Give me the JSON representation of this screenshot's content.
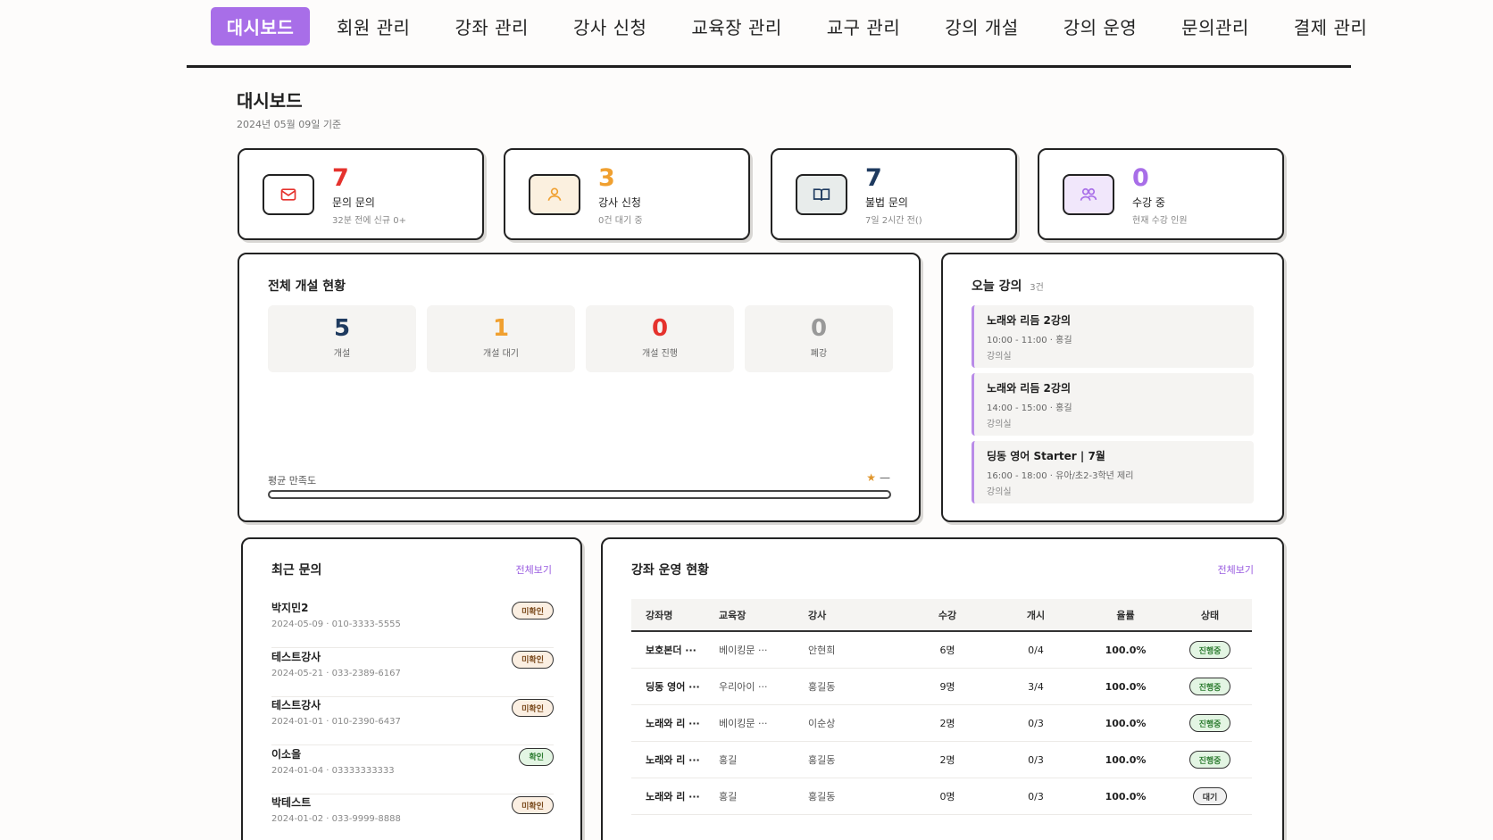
{
  "nav": {
    "items": [
      {
        "label": "대시보드",
        "active": true
      },
      {
        "label": "회원 관리",
        "active": false
      },
      {
        "label": "강좌 관리",
        "active": false
      },
      {
        "label": "강사 신청",
        "active": false
      },
      {
        "label": "교육장 관리",
        "active": false
      },
      {
        "label": "교구 관리",
        "active": false
      },
      {
        "label": "강의 개설",
        "active": false
      },
      {
        "label": "강의 운영",
        "active": false
      },
      {
        "label": "문의관리",
        "active": false
      },
      {
        "label": "결제 관리",
        "active": false
      }
    ]
  },
  "header": {
    "title": "대시보드",
    "date": "2024년 05월 09일 기준"
  },
  "colors": {
    "accent": "#a86ee8",
    "red": "#e5322d",
    "orange": "#f0a030",
    "navy": "#1e3a5f",
    "purple": "#a86ee8"
  },
  "stats": [
    {
      "icon": "mail-icon",
      "value": "7",
      "label": "문의 문의",
      "sub": "32분 전에 신규 0+",
      "color": "#e5322d",
      "icon_bg": "#fff",
      "icon_color": "#e5322d"
    },
    {
      "icon": "person-icon",
      "value": "3",
      "label": "강사 신청",
      "sub": "0건 대기 중",
      "color": "#f0a030",
      "icon_bg": "#fbf0df",
      "icon_color": "#f0a030"
    },
    {
      "icon": "book-icon",
      "value": "7",
      "label": "불법 문의",
      "sub": "7일 2시간 전()",
      "color": "#1e3a5f",
      "icon_bg": "#e8eceb",
      "icon_color": "#1e3a5f"
    },
    {
      "icon": "users-icon",
      "value": "0",
      "label": "수강 중",
      "sub": "현재 수강 인원",
      "color": "#a86ee8",
      "icon_bg": "#f1e7fb",
      "icon_color": "#a86ee8"
    }
  ],
  "overall": {
    "title": "전체 개설 현황",
    "kpis": [
      {
        "value": "5",
        "label": "개설",
        "color": "#1e3a5f"
      },
      {
        "value": "1",
        "label": "개설 대기",
        "color": "#f0a030"
      },
      {
        "value": "0",
        "label": "개설 진행",
        "color": "#e5322d"
      },
      {
        "value": "0",
        "label": "폐강",
        "color": "#999999"
      }
    ],
    "satisfaction_label": "평균 만족도",
    "satisfaction_star": "★",
    "satisfaction_value": "—",
    "satisfaction_fraction": 0
  },
  "today": {
    "title": "오늘 강의",
    "count": "3건",
    "lectures": [
      {
        "title": "노래와 리듬 2강의",
        "time": "10:00 - 11:00 · 홍길",
        "room": "강의실"
      },
      {
        "title": "노래와 리듬 2강의",
        "time": "14:00 - 15:00 · 홍길",
        "room": "강의실"
      },
      {
        "title": "딩동 영어 Starter | 7월",
        "time": "16:00 - 18:00 · 유아/초2-3학년 제리",
        "room": "강의실"
      }
    ]
  },
  "recent": {
    "title": "최근 문의",
    "see_all": "전체보기",
    "items": [
      {
        "name": "박지민2",
        "meta": "2024-05-09 · 010-3333-5555",
        "status": "미확인",
        "kind": "pending"
      },
      {
        "name": "테스트강사",
        "meta": "2024-05-21 · 033-2389-6167",
        "status": "미확인",
        "kind": "pending"
      },
      {
        "name": "테스트강사",
        "meta": "2024-01-01 · 010-2390-6437",
        "status": "미확인",
        "kind": "pending"
      },
      {
        "name": "이소을",
        "meta": "2024-01-04 · 03333333333",
        "status": "확인",
        "kind": "ok"
      },
      {
        "name": "박테스트",
        "meta": "2024-01-02 · 033-9999-8888",
        "status": "미확인",
        "kind": "pending"
      }
    ]
  },
  "ops": {
    "title": "강좌 운영 현황",
    "see_all": "전체보기",
    "columns": [
      "강좌명",
      "교육장",
      "강사",
      "수강",
      "개시",
      "율률",
      "상태"
    ],
    "rows": [
      {
        "course": "보호본더 ···",
        "venue": "베이킹문 ···",
        "teacher": "안현희",
        "students": "6명",
        "open": "0/4",
        "rate": "100.0%",
        "status": "진행중",
        "kind": "run"
      },
      {
        "course": "딩동 영어 ···",
        "venue": "우리아이 ···",
        "teacher": "홍길동",
        "students": "9명",
        "open": "3/4",
        "rate": "100.0%",
        "status": "진행중",
        "kind": "run"
      },
      {
        "course": "노래와 리 ···",
        "venue": "베이킹문 ···",
        "teacher": "이순상",
        "students": "2명",
        "open": "0/3",
        "rate": "100.0%",
        "status": "진행중",
        "kind": "run"
      },
      {
        "course": "노래와 리 ···",
        "venue": "홍길",
        "teacher": "홍길동",
        "students": "2명",
        "open": "0/3",
        "rate": "100.0%",
        "status": "진행중",
        "kind": "run"
      },
      {
        "course": "노래와 리 ···",
        "venue": "홍길",
        "teacher": "홍길동",
        "students": "0명",
        "open": "0/3",
        "rate": "100.0%",
        "status": "대기",
        "kind": "wait"
      }
    ]
  }
}
